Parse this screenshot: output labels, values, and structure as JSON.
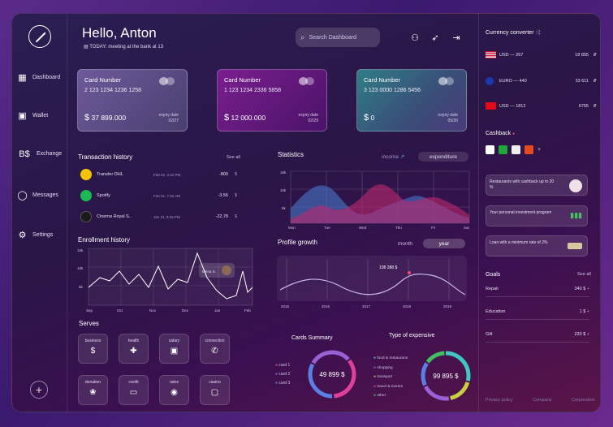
{
  "sidebar": {
    "items": [
      {
        "label": "Dashboard",
        "icon": "dashboard-icon"
      },
      {
        "label": "Wallet",
        "icon": "wallet-icon"
      },
      {
        "label": "Exchange",
        "icon": "exchange-icon"
      },
      {
        "label": "Messages",
        "icon": "messages-icon"
      },
      {
        "label": "Settings",
        "icon": "gear-icon"
      }
    ],
    "plus": "+"
  },
  "header": {
    "greeting": "Hello, Anton",
    "today": "TODAY: meeting at the bank at 13",
    "search_placeholder": "Search Dashboard"
  },
  "cards": [
    {
      "title": "Card Number",
      "number": "2 123 1234 1236 1258",
      "currency": "$",
      "amount": "37 899.000",
      "exp_label": "expiry date",
      "exp": "02/27"
    },
    {
      "title": "Card Number",
      "number": "1 123 1234 2336 5858",
      "currency": "$",
      "amount": "12 000.000",
      "exp_label": "expiry date",
      "exp": "02/29"
    },
    {
      "title": "Card Number",
      "number": "3 123 0000 1286 5456",
      "currency": "$",
      "amount": "0",
      "exp_label": "expiry date",
      "exp": "05/30"
    }
  ],
  "transactions": {
    "title": "Transaction history",
    "see_all": "See all",
    "rows": [
      {
        "name": "Transfer DHL",
        "date": "Feb 02, 2:22 PM",
        "amount": "-800",
        "cur": "$",
        "color": "#f5c400"
      },
      {
        "name": "Spotify",
        "date": "Feb 01, 7:32 AM",
        "amount": "-3.56",
        "cur": "$",
        "color": "#1db954"
      },
      {
        "name": "Cinema Royal S..",
        "date": "Jan 31, 9:25 PM",
        "amount": "-22,78",
        "cur": "$",
        "color": "#222"
      }
    ]
  },
  "statistics": {
    "title": "Statistics",
    "income": "income",
    "expenditure": "expenditure",
    "y_ticks": [
      "15k",
      "10k",
      "5k"
    ],
    "x_ticks": [
      "Mon",
      "Tue",
      "Wed",
      "Thu",
      "Fri",
      "Sat"
    ]
  },
  "enrollment": {
    "title": "Enrollment history",
    "user": "Elena S.",
    "y_ticks": [
      "15k",
      "10k",
      "5k"
    ],
    "x_ticks": [
      "Sep",
      "Oct",
      "Nov",
      "Dec",
      "Jan",
      "Feb"
    ]
  },
  "profile": {
    "title": "Profile growth",
    "tab_month": "month",
    "tab_year": "year",
    "callout": "108 288",
    "callout_cur": "$",
    "x_ticks": [
      "2015",
      "2016",
      "2017",
      "2018",
      "2019"
    ]
  },
  "serves": {
    "title": "Serves",
    "items": [
      {
        "label": "business",
        "icon": "coins-icon",
        "glyph": "$"
      },
      {
        "label": "health",
        "icon": "medkit-icon",
        "glyph": "✚"
      },
      {
        "label": "salary",
        "icon": "wallet-icon",
        "glyph": "▣"
      },
      {
        "label": "connection",
        "icon": "phone-icon",
        "glyph": "✆"
      },
      {
        "label": "donation",
        "icon": "donation-icon",
        "glyph": "❀"
      },
      {
        "label": "credit",
        "icon": "credit-card-icon",
        "glyph": "▭"
      },
      {
        "label": "rates",
        "icon": "rates-icon",
        "glyph": "◉"
      },
      {
        "label": "casino",
        "icon": "casino-icon",
        "glyph": "▢"
      }
    ]
  },
  "cards_summary": {
    "title": "Cards Summary",
    "legend": [
      "card 1",
      "card 2",
      "card 3"
    ],
    "total": "49 899",
    "cur": "$"
  },
  "expense": {
    "title": "Type of expensive",
    "legend": [
      "food & restaurans",
      "shopping",
      "transport",
      "travel & events",
      "other"
    ],
    "total": "99 895",
    "cur": "$"
  },
  "converter": {
    "title": "Currency converter",
    "rows": [
      {
        "flag": "us",
        "code": "USD",
        "sep": "—",
        "amount": "267",
        "value": "18 855",
        "sym": "₽"
      },
      {
        "flag": "eu",
        "code": "EURO",
        "sep": "—",
        "amount": "440",
        "value": "33 611",
        "sym": "₽"
      },
      {
        "flag": "tr",
        "code": "USD",
        "sep": "—",
        "amount": "1812",
        "value": "6755",
        "sym": "₽"
      }
    ]
  },
  "cashback": {
    "title": "Cashback",
    "add": "+",
    "offers": [
      "Restaurants with cashback up to 20 %",
      "Your personal investment program",
      "Loan with a minimum rate of 2%"
    ]
  },
  "goals": {
    "title": "Goals",
    "see_all": "See all",
    "items": [
      {
        "name": "Repair",
        "value": "340",
        "cur": "$"
      },
      {
        "name": "Education",
        "value": "1",
        "cur": "$"
      },
      {
        "name": "Gift",
        "value": "233",
        "cur": "$"
      }
    ],
    "plus": "+"
  },
  "footer": [
    "Privacy policy",
    "Company",
    "Corporation"
  ]
}
